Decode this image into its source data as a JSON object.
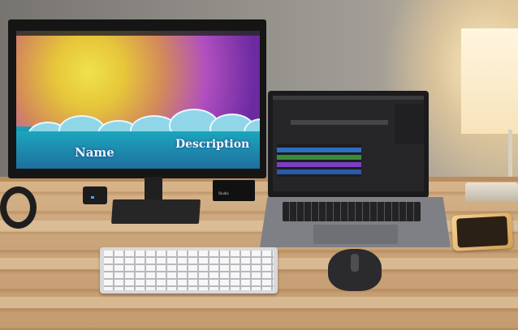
{
  "scene": {
    "monitor": {
      "name_text": "Name",
      "description_text": "Description"
    },
    "audio_box": {
      "label": "Studio"
    }
  },
  "colors": {
    "wall": "#8c8984",
    "desk": "#caa47a",
    "screen_band": "#1a9fb8"
  },
  "icons": [
    "headphones-icon",
    "mouse-icon",
    "keyboard-icon",
    "phone-icon",
    "lamp-icon"
  ]
}
